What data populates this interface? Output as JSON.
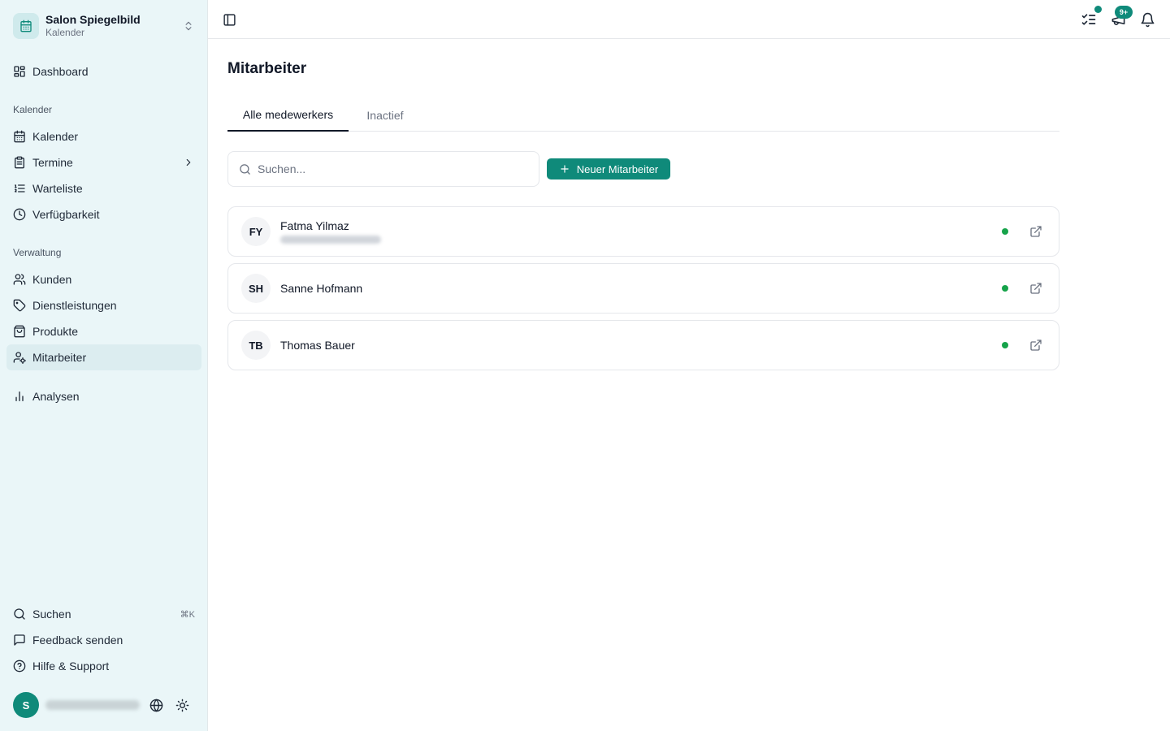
{
  "brand": {
    "name": "Salon Spiegelbild",
    "subtitle": "Kalender",
    "icon": "calendar-icon",
    "chevron": "chevrons-up-down-icon"
  },
  "sidebar": {
    "dashboard": {
      "label": "Dashboard",
      "icon": "dashboard-icon"
    },
    "sections": {
      "kalender": "Kalender",
      "verwaltung": "Verwaltung"
    },
    "kalender_items": [
      {
        "label": "Kalender",
        "icon": "calendar-icon"
      },
      {
        "label": "Termine",
        "icon": "clipboard-icon"
      },
      {
        "label": "Warteliste",
        "icon": "list-ordered-icon"
      },
      {
        "label": "Verfügbarkeit",
        "icon": "clock-icon"
      }
    ],
    "verwaltung_items": [
      {
        "label": "Kunden",
        "icon": "users-icon"
      },
      {
        "label": "Dienstleistungen",
        "icon": "tag-icon"
      },
      {
        "label": "Produkte",
        "icon": "shopping-bag-icon"
      },
      {
        "label": "Mitarbeiter",
        "icon": "user-cog-icon",
        "active": true
      }
    ],
    "analysen": {
      "label": "Analysen",
      "icon": "bar-chart-icon"
    },
    "footer_items": [
      {
        "label": "Suchen",
        "icon": "search-icon",
        "shortcut": "⌘K"
      },
      {
        "label": "Feedback senden",
        "icon": "message-square-icon"
      },
      {
        "label": "Hilfe & Support",
        "icon": "help-circle-icon"
      }
    ],
    "user": {
      "initial": "S"
    }
  },
  "topbar": {
    "notifications_badge": "9+"
  },
  "page": {
    "title": "Mitarbeiter",
    "tabs": [
      {
        "label": "Alle medewerkers",
        "active": true
      },
      {
        "label": "Inactief",
        "active": false
      }
    ],
    "search": {
      "placeholder": "Suchen...",
      "value": ""
    },
    "new_button": "Neuer Mitarbeiter"
  },
  "employees": [
    {
      "initials": "FY",
      "name": "Fatma Yilmaz",
      "has_email": true,
      "status": "active"
    },
    {
      "initials": "SH",
      "name": "Sanne Hofmann",
      "has_email": false,
      "status": "active"
    },
    {
      "initials": "TB",
      "name": "Thomas Bauer",
      "has_email": false,
      "status": "active"
    }
  ],
  "colors": {
    "accent": "#0f8a7a",
    "status_active": "#16a34a",
    "sidebar_bg": "#eaf6f8"
  }
}
